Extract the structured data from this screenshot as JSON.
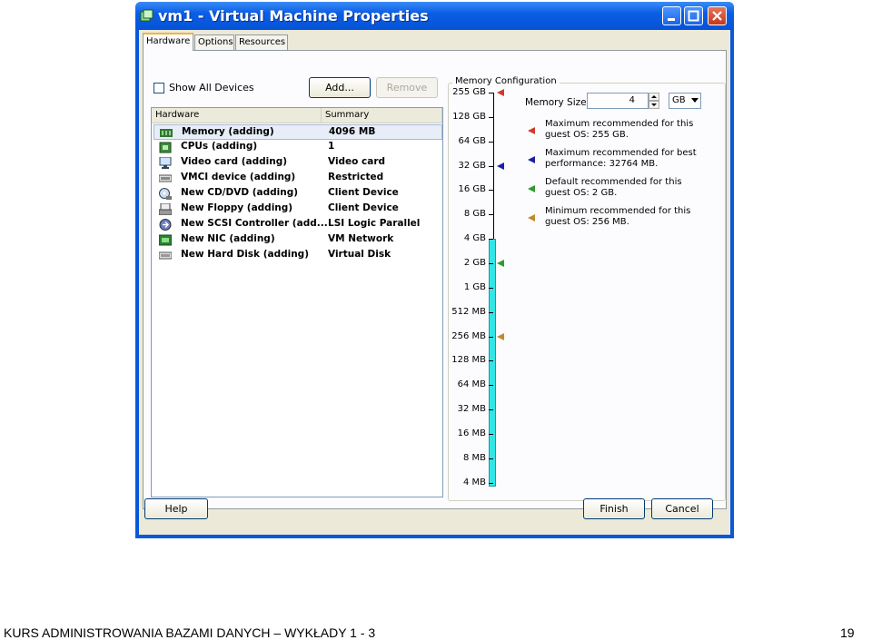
{
  "window": {
    "title": "vm1 - Virtual Machine Properties"
  },
  "tabs": [
    {
      "label": "Hardware",
      "active": true
    },
    {
      "label": "Options",
      "active": false
    },
    {
      "label": "Resources",
      "active": false
    }
  ],
  "hardware": {
    "show_all_label": "Show All Devices",
    "show_all_checked": false,
    "add_label": "Add...",
    "remove_label": "Remove",
    "columns": [
      "Hardware",
      "Summary"
    ],
    "rows": [
      {
        "name": "Memory (adding)",
        "summary": "4096 MB",
        "icon": "memory-icon",
        "selected": true
      },
      {
        "name": "CPUs (adding)",
        "summary": "1",
        "icon": "cpu-icon"
      },
      {
        "name": "Video card  (adding)",
        "summary": "Video card",
        "icon": "monitor-icon"
      },
      {
        "name": "VMCI device (adding)",
        "summary": "Restricted",
        "icon": "vmci-icon"
      },
      {
        "name": "New CD/DVD (adding)",
        "summary": "Client Device",
        "icon": "cdrom-icon"
      },
      {
        "name": "New Floppy (adding)",
        "summary": "Client Device",
        "icon": "floppy-icon"
      },
      {
        "name": "New SCSI Controller (add...",
        "summary": "LSI Logic Parallel",
        "icon": "scsi-icon"
      },
      {
        "name": "New NIC (adding)",
        "summary": "VM Network",
        "icon": "nic-icon"
      },
      {
        "name": "New Hard Disk (adding)",
        "summary": "Virtual Disk",
        "icon": "disk-icon"
      }
    ]
  },
  "memory": {
    "group_title": "Memory Configuration",
    "size_label": "Memory Size:",
    "size_value": "4",
    "unit": "GB",
    "scale": [
      "255 GB",
      "128 GB",
      "64 GB",
      "32 GB",
      "16 GB",
      "8 GB",
      "4 GB",
      "2 GB",
      "1 GB",
      "512 MB",
      "256 MB",
      "128 MB",
      "64 MB",
      "32 MB",
      "16 MB",
      "8 MB",
      "4 MB"
    ],
    "legend": [
      {
        "text": "Maximum recommended for this guest OS: 255 GB.",
        "color": "#d03a2a"
      },
      {
        "text": "Maximum recommended for best performance: 32764 MB.",
        "color": "#1b1fa8"
      },
      {
        "text": "Default recommended for this guest OS: 2 GB.",
        "color": "#2f9a2f"
      },
      {
        "text": "Minimum recommended for this guest OS: 256 MB.",
        "color": "#c08a2a"
      }
    ],
    "bar_color": "#33e6e6"
  },
  "footer_buttons": {
    "help": "Help",
    "finish": "Finish",
    "cancel": "Cancel"
  },
  "slide": {
    "footer_text": "KURS ADMINISTROWANIA BAZAMI DANYCH – WYKŁADY 1 - 3",
    "page_number": "19"
  }
}
